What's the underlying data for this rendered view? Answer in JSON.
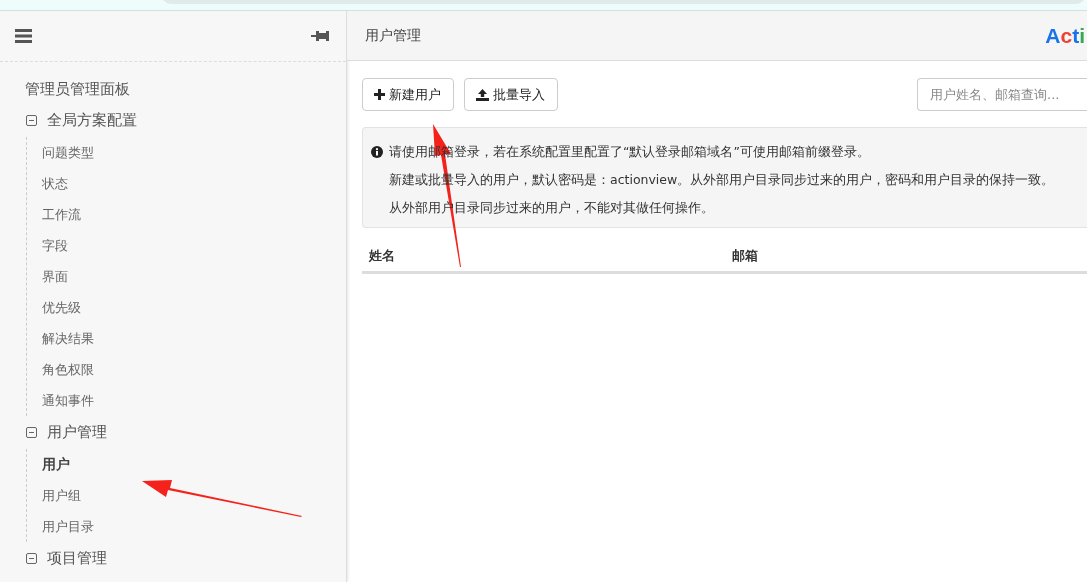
{
  "sidebar": {
    "title": "管理员管理面板",
    "groups": [
      {
        "label": "全局方案配置",
        "expanded": true,
        "children": [
          {
            "label": "问题类型",
            "selected": false
          },
          {
            "label": "状态",
            "selected": false
          },
          {
            "label": "工作流",
            "selected": false
          },
          {
            "label": "字段",
            "selected": false
          },
          {
            "label": "界面",
            "selected": false
          },
          {
            "label": "优先级",
            "selected": false
          },
          {
            "label": "解决结果",
            "selected": false
          },
          {
            "label": "角色权限",
            "selected": false
          },
          {
            "label": "通知事件",
            "selected": false
          }
        ]
      },
      {
        "label": "用户管理",
        "expanded": true,
        "children": [
          {
            "label": "用户",
            "selected": true
          },
          {
            "label": "用户组",
            "selected": false
          },
          {
            "label": "用户目录",
            "selected": false
          }
        ]
      },
      {
        "label": "项目管理",
        "expanded": true
      }
    ]
  },
  "header": {
    "title": "用户管理",
    "logo": [
      {
        "text": "A",
        "color": "#1a73e8"
      },
      {
        "text": "c",
        "color": "#ea4335"
      },
      {
        "text": "t",
        "color": "#1a73e8"
      },
      {
        "text": "i",
        "color": "#34a853"
      }
    ]
  },
  "toolbar": {
    "buttons": [
      {
        "kind": "plus",
        "label": "新建用户"
      },
      {
        "kind": "upload",
        "label": "批量导入"
      }
    ],
    "search": {
      "placeholder": "用户姓名、邮箱查询..."
    }
  },
  "notice": [
    "请使用邮箱登录，若在系统配置里配置了“默认登录邮箱域名”可使用邮箱前缀登录。",
    "新建或批量导入的用户，默认密码是：actionview。从外部用户目录同步过来的用户，密码和用户目录的保持一致。",
    "从外部用户目录同步过来的用户，不能对其做任何操作。"
  ],
  "table": {
    "columns": [
      "姓名",
      "邮箱"
    ]
  }
}
